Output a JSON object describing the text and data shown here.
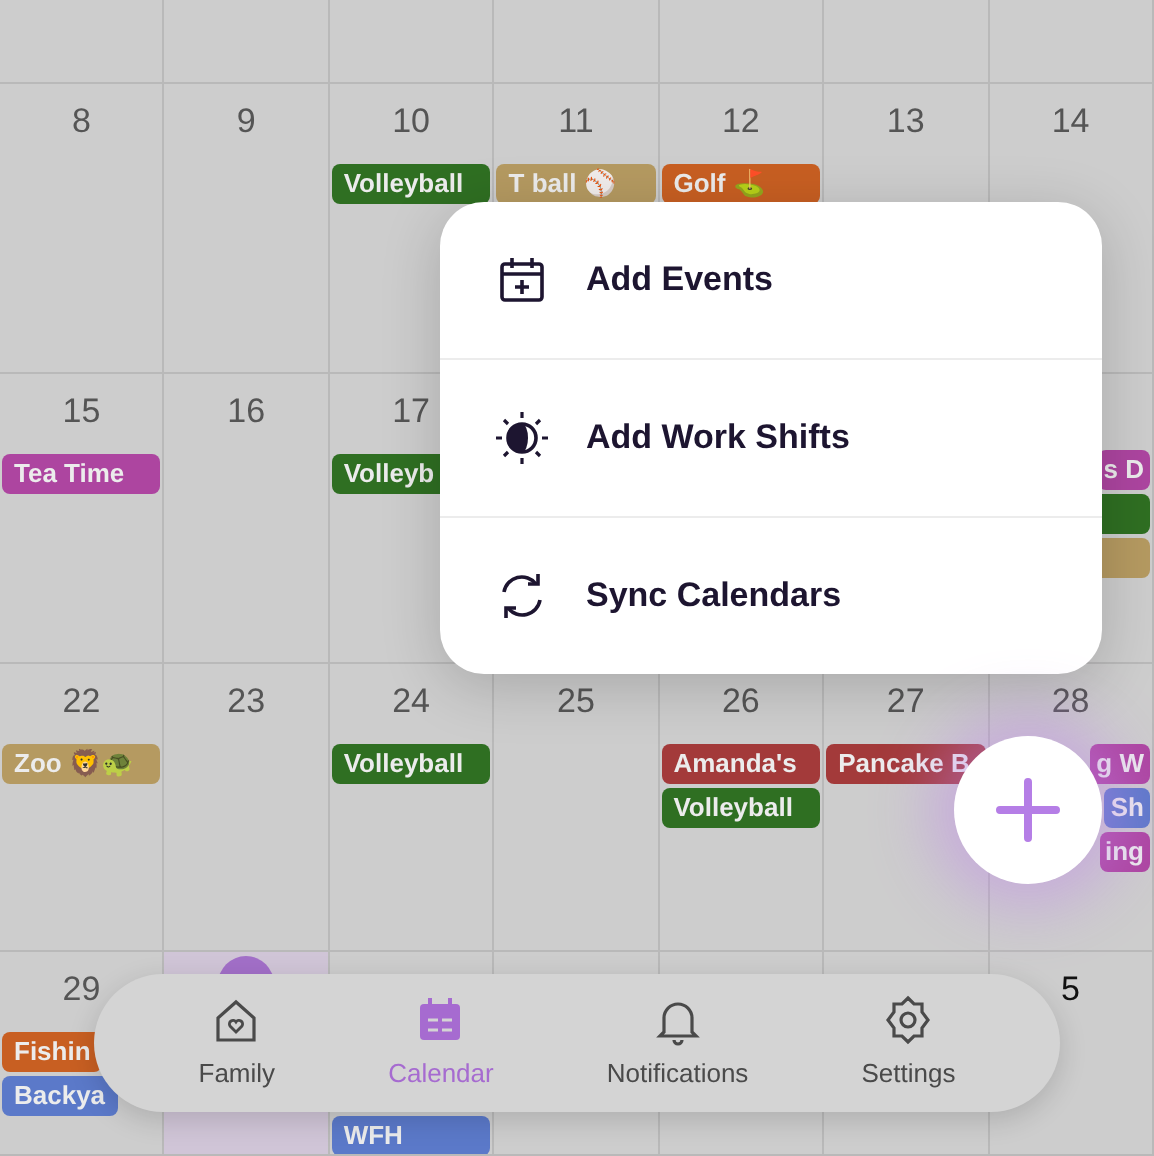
{
  "weeks": [
    {
      "days": [
        {
          "kind": "blank"
        },
        {
          "kind": "blank"
        },
        {
          "kind": "blank"
        },
        {
          "kind": "blank"
        },
        {
          "kind": "blank"
        },
        {
          "kind": "blank"
        },
        {
          "kind": "blank"
        }
      ]
    },
    {
      "days": [
        {
          "kind": "day",
          "date": "8"
        },
        {
          "kind": "day",
          "date": "9"
        },
        {
          "kind": "day",
          "date": "10",
          "events": [
            {
              "title": "Volleyball",
              "color": "#2f6f22"
            }
          ]
        },
        {
          "kind": "day",
          "date": "11",
          "events": [
            {
              "title": "T ball ⚾",
              "color": "#b59a61"
            }
          ]
        },
        {
          "kind": "day",
          "date": "12",
          "events": [
            {
              "title": "Golf ⛳",
              "color": "#c85f22"
            }
          ]
        },
        {
          "kind": "day",
          "date": "13"
        },
        {
          "kind": "day",
          "date": "14"
        }
      ]
    },
    {
      "days": [
        {
          "kind": "day",
          "date": "15",
          "events": [
            {
              "title": "Tea Time",
              "color": "#ad45a0"
            }
          ]
        },
        {
          "kind": "day",
          "date": "16"
        },
        {
          "kind": "day",
          "date": "17",
          "events": [
            {
              "title": "Volleyb",
              "color": "#2f6f22"
            }
          ]
        },
        {
          "kind": "covered"
        },
        {
          "kind": "covered"
        },
        {
          "kind": "covered"
        },
        {
          "kind": "day",
          "events": [
            {
              "title": "s D",
              "color": "#ad45a0"
            },
            {
              "color": "#2f6f22"
            },
            {
              "color": "#b59a61"
            }
          ]
        }
      ]
    },
    {
      "days": [
        {
          "kind": "day",
          "date": "22",
          "events": [
            {
              "title": "Zoo 🦁🐢",
              "color": "#b59a61"
            }
          ]
        },
        {
          "kind": "day",
          "date": "23"
        },
        {
          "kind": "day",
          "date": "24",
          "events": [
            {
              "title": "Volleyball",
              "color": "#2f6f22"
            }
          ]
        },
        {
          "kind": "day",
          "date": "25"
        },
        {
          "kind": "day",
          "date": "26",
          "events": [
            {
              "title": "Amanda's",
              "color": "#a33a3a"
            },
            {
              "title": "Volleyball",
              "color": "#2f6f22"
            }
          ]
        },
        {
          "kind": "day",
          "date": "27",
          "events": [
            {
              "title": "Pancake B",
              "color": "#a33a3a"
            }
          ]
        },
        {
          "kind": "day",
          "date": "28",
          "events": [
            {
              "title": "g W",
              "color": "#ad45a0"
            },
            {
              "title": "Sh",
              "color": "#5b79c9"
            },
            {
              "title": "ing",
              "color": "#ad45a0"
            }
          ]
        }
      ]
    },
    {
      "days": [
        {
          "kind": "day",
          "date": "29",
          "events": [
            {
              "title": "Fishin",
              "color": "#c85f22"
            },
            {
              "title": "Backya",
              "color": "#5b79c9"
            }
          ]
        },
        {
          "kind": "day",
          "today": true
        },
        {
          "kind": "day",
          "events": [
            {
              "title": "WFH",
              "color": "#5b79c9"
            }
          ]
        },
        {
          "kind": "blank"
        },
        {
          "kind": "blank"
        },
        {
          "kind": "blank"
        },
        {
          "kind": "day",
          "date": "5"
        }
      ]
    }
  ],
  "menu": [
    {
      "label": "Add Events",
      "kind": "calendar"
    },
    {
      "label": "Add Work Shifts",
      "kind": "sun"
    },
    {
      "label": "Sync Calendars",
      "kind": "sync"
    }
  ],
  "tabs": [
    {
      "label": "Family",
      "kind": "home",
      "selected": false
    },
    {
      "label": "Calendar",
      "kind": "calendar",
      "selected": true
    },
    {
      "label": "Notifications",
      "kind": "bell",
      "selected": false
    },
    {
      "label": "Settings",
      "kind": "gear",
      "selected": false
    }
  ]
}
